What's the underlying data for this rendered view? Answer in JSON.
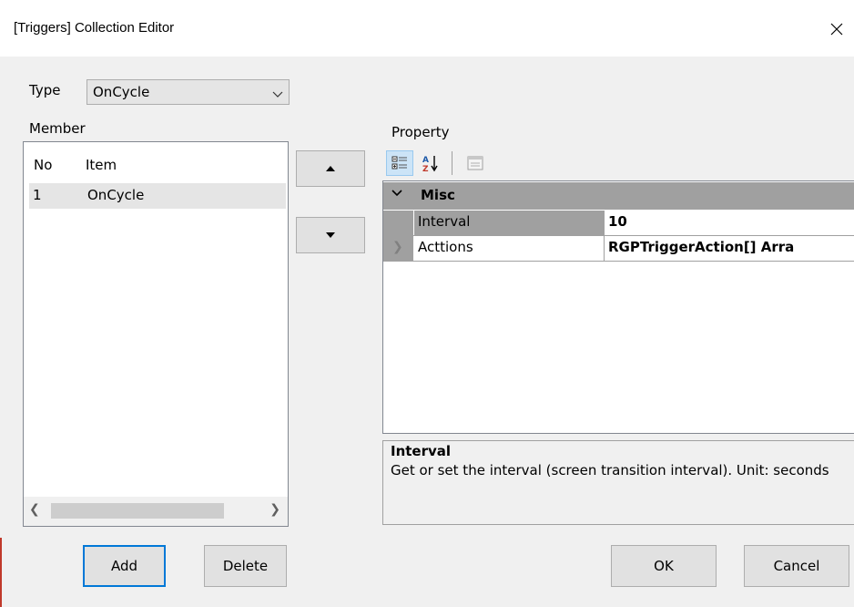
{
  "window": {
    "title": "[Triggers] Collection Editor",
    "close_icon": "close-icon"
  },
  "type_select": {
    "label": "Type",
    "value": "OnCycle"
  },
  "member": {
    "label": "Member",
    "columns": [
      "No",
      "Item"
    ],
    "rows": [
      {
        "no": "1",
        "item": "OnCycle"
      }
    ]
  },
  "property": {
    "label": "Property",
    "toolbar_icons": [
      "categorized-icon",
      "alphabetical-icon",
      "property-pages-icon"
    ],
    "category": "Misc",
    "rows": [
      {
        "name": "Interval",
        "value": "10"
      },
      {
        "name": "Acttions",
        "value": "RGPTriggerAction[] Arra"
      }
    ],
    "help": {
      "title": "Interval",
      "description": "Get or set the interval (screen transition interval). Unit: seconds"
    }
  },
  "buttons": {
    "add": "Add",
    "delete": "Delete",
    "ok": "OK",
    "cancel": "Cancel"
  },
  "colors": {
    "selection_gray": "#e5e5e5",
    "category_gray": "#a0a0a0",
    "focus_blue": "#0078d7"
  }
}
